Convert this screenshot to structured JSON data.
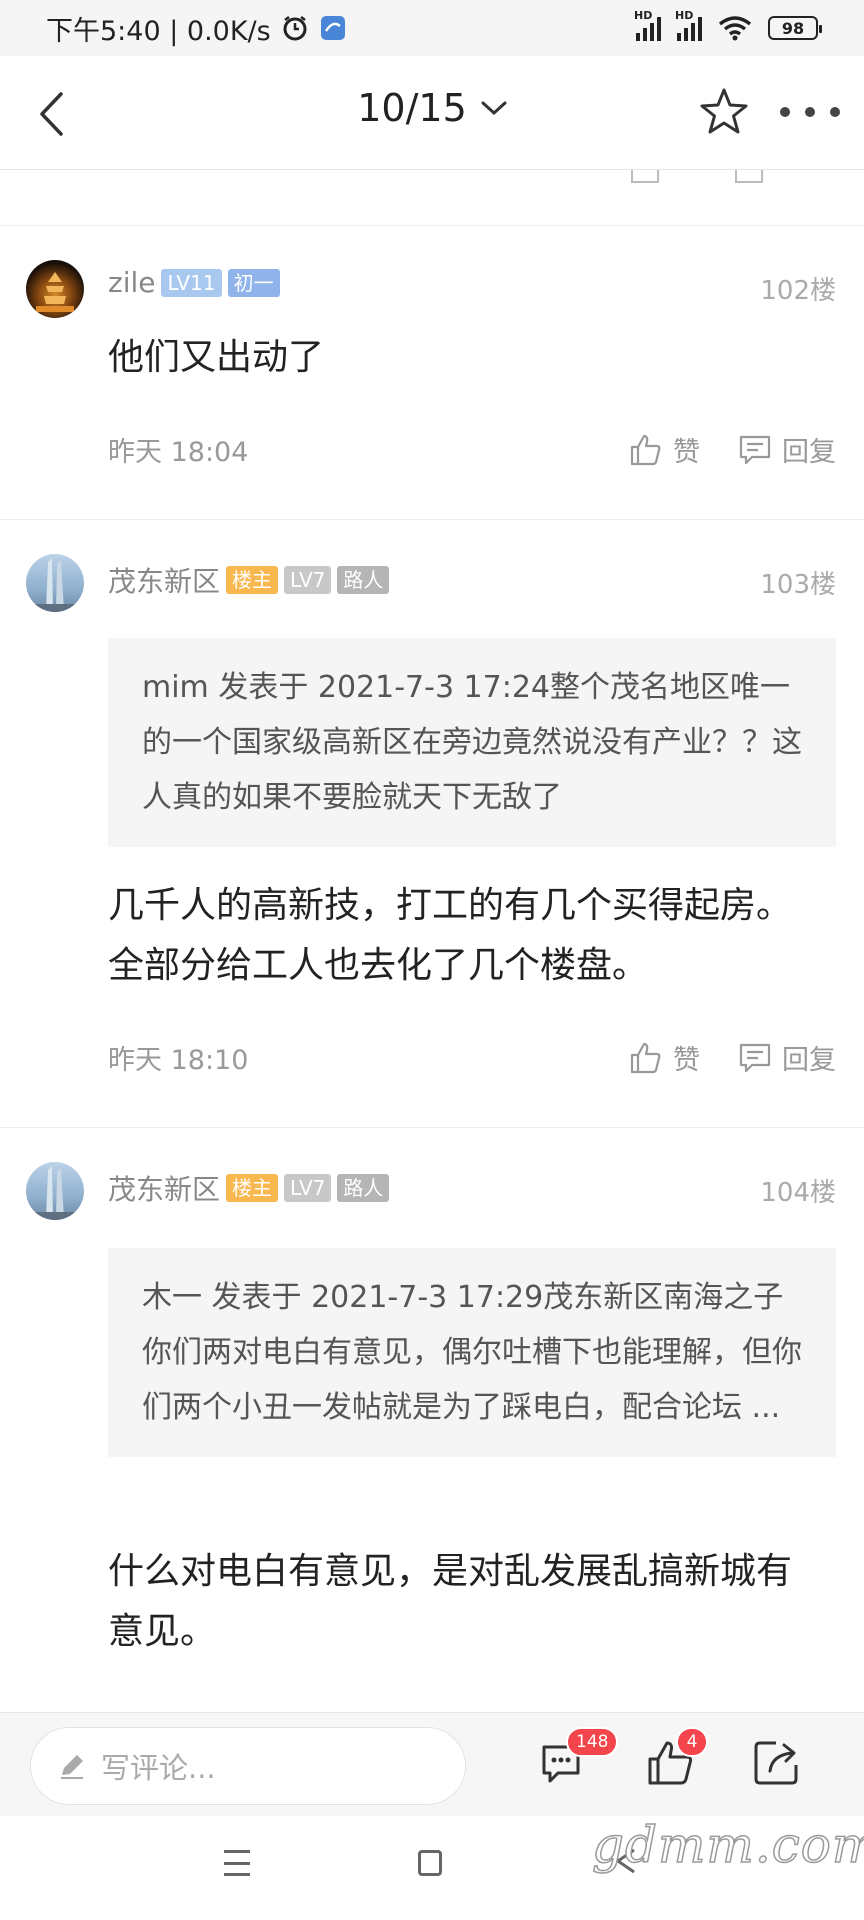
{
  "status_bar": {
    "time_net": "下午5:40 | 0.0K/s",
    "hd1": "HD",
    "hd2": "HD",
    "battery": "98"
  },
  "nav": {
    "page_indicator": "10/15"
  },
  "posts": [
    {
      "username": "zile",
      "level": "LV11",
      "title_badge": "初一",
      "floor": "102楼",
      "content": "他们又出动了",
      "time": "昨天 18:04",
      "like_label": "赞",
      "reply_label": "回复"
    },
    {
      "username": "茂东新区",
      "host_badge": "楼主",
      "level": "LV7",
      "title_badge": "路人",
      "floor": "103楼",
      "quote": "mim 发表于 2021-7-3 17:24整个茂名地区唯一的一个国家级高新区在旁边竟然说没有产业？？这人真的如果不要脸就天下无敌了",
      "content": "几千人的高新技，打工的有几个买得起房。全部分给工人也去化了几个楼盘。",
      "time": "昨天 18:10",
      "like_label": "赞",
      "reply_label": "回复"
    },
    {
      "username": "茂东新区",
      "host_badge": "楼主",
      "level": "LV7",
      "title_badge": "路人",
      "floor": "104楼",
      "quote": "木一 发表于 2021-7-3 17:29茂东新区南海之子你们两对电白有意见，偶尔吐槽下也能理解，但你们两个小丑一发帖就是为了踩电白，配合论坛 ...",
      "content": "什么对电白有意见，是对乱发展乱搞新城有意见。"
    }
  ],
  "bottom_bar": {
    "comment_placeholder": "写评论...",
    "comment_count": "148",
    "like_count": "4"
  },
  "watermark": "gdmm.com",
  "colors": {
    "host_badge": "#f9b84f",
    "level_blue": "#a9c8f0",
    "badge_red": "#f3454b"
  }
}
